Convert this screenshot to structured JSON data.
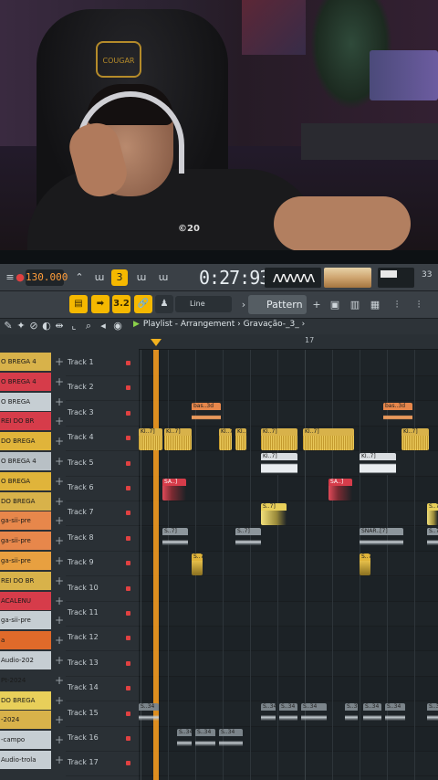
{
  "webcam": {
    "chair_brand": "COUGAR",
    "shirt_text": "©20"
  },
  "toolbar": {
    "tempo": "130.000",
    "time": "0:27:93",
    "scope_wave": "ʌʌʌʌʌʌ",
    "cpu": "33",
    "snap": "3.2",
    "line_label": "Line",
    "pattern_label": "Pattern 1"
  },
  "playlist": {
    "title": "Playlist - Arrangement",
    "arrangement": "Gravação-_3_",
    "ruler_mark": "17"
  },
  "channels": [
    {
      "label": "O BREGA 4",
      "color": "#d8b24a"
    },
    {
      "label": "O BREGA 4",
      "color": "#d63c4a"
    },
    {
      "label": "O BREGA",
      "color": "#c6ced3"
    },
    {
      "label": "REI DO BR",
      "color": "#d63c4a"
    },
    {
      "label": "DO BREGA",
      "color": "#e0b43a"
    },
    {
      "label": "O BREGA 4",
      "color": "#b8c0c5"
    },
    {
      "label": "O BREGA",
      "color": "#e0b43a"
    },
    {
      "label": "DO BREGA",
      "color": "#d8b24a"
    },
    {
      "label": "ga-sii-pre",
      "color": "#e7874b"
    },
    {
      "label": "ga-sii-pre",
      "color": "#e7874b"
    },
    {
      "label": "ga-sii-pre",
      "color": "#e8a040"
    },
    {
      "label": "REI DO BR",
      "color": "#d8b24a"
    },
    {
      "label": "ACALENU",
      "color": "#d63c4a"
    },
    {
      "label": "ga-sii-pre",
      "color": "#c6ced3"
    },
    {
      "label": "a",
      "color": "#e06a2a"
    },
    {
      "label": "Audio-202",
      "color": "#c6ced3"
    },
    {
      "label": "Pt-2024",
      "color": "#2a3035"
    },
    {
      "label": "DO BREGA",
      "color": "#e8cf5a"
    },
    {
      "label": "-2024",
      "color": "#d8b24a"
    },
    {
      "label": "-campo",
      "color": "#c6ced3"
    },
    {
      "label": "Audio-trola",
      "color": "#c6ced3"
    }
  ],
  "tracks": [
    "Track 1",
    "Track 2",
    "Track 3",
    "Track 4",
    "Track 5",
    "Track 6",
    "Track 7",
    "Track 8",
    "Track 9",
    "Track 10",
    "Track 11",
    "Track 12",
    "Track 13",
    "Track 14",
    "Track 15",
    "Track 16",
    "Track 17"
  ],
  "clip_labels": {
    "bass": "bas..3d",
    "kick": "KI..7]",
    "sample": "SA..]",
    "snare": "S..7]",
    "snare_long": "SNAR..[7]",
    "shot": "S..34"
  }
}
